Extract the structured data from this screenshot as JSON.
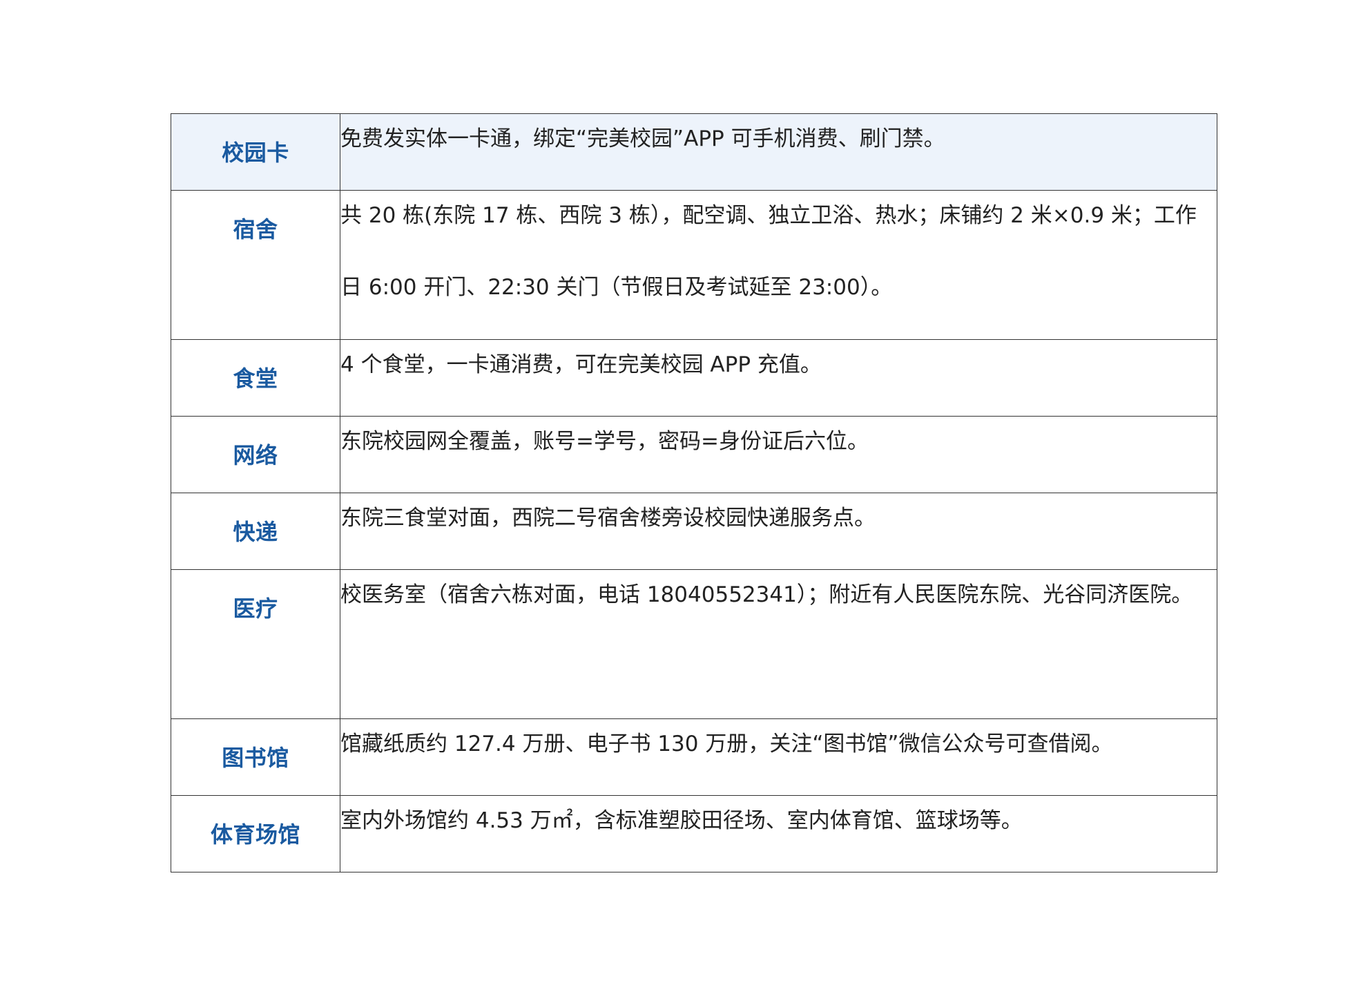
{
  "rows": [
    {
      "label": "校园卡",
      "content": "免费发实体一卡通，绑定“完美校园”APP 可手机消费、刷门禁。"
    },
    {
      "label": "宿舍",
      "content": "共 20 栋(东院 17 栋、西院 3 栋），配空调、独立卫浴、热水；床铺约 2 米×0.9 米；工作日 6:00 开门、22:30 关门（节假日及考试延至 23:00）。"
    },
    {
      "label": "食堂",
      "content": "4 个食堂，一卡通消费，可在完美校园 APP 充值。"
    },
    {
      "label": "网络",
      "content": "东院校园网全覆盖，账号=学号，密码=身份证后六位。"
    },
    {
      "label": "快递",
      "content": "东院三食堂对面，西院二号宿舍楼旁设校园快递服务点。"
    },
    {
      "label": "医疗",
      "content": "校医务室（宿舍六栋对面，电话 18040552341）；附近有人民医院东院、光谷同济医院。"
    },
    {
      "label": "图书馆",
      "content": "馆藏纸质约 127.4 万册、电子书 130 万册，关注“图书馆”微信公众号可查借阅。"
    },
    {
      "label": "体育场馆",
      "content": "室内外场馆约 4.53 万㎡，含标准塑胶田径场、室内体育馆、篮球场等。"
    }
  ],
  "colors": {
    "label_text": "#1a5aa0",
    "highlight_bg": "#edf3fb",
    "border": "#333333",
    "body_text": "#222222"
  }
}
